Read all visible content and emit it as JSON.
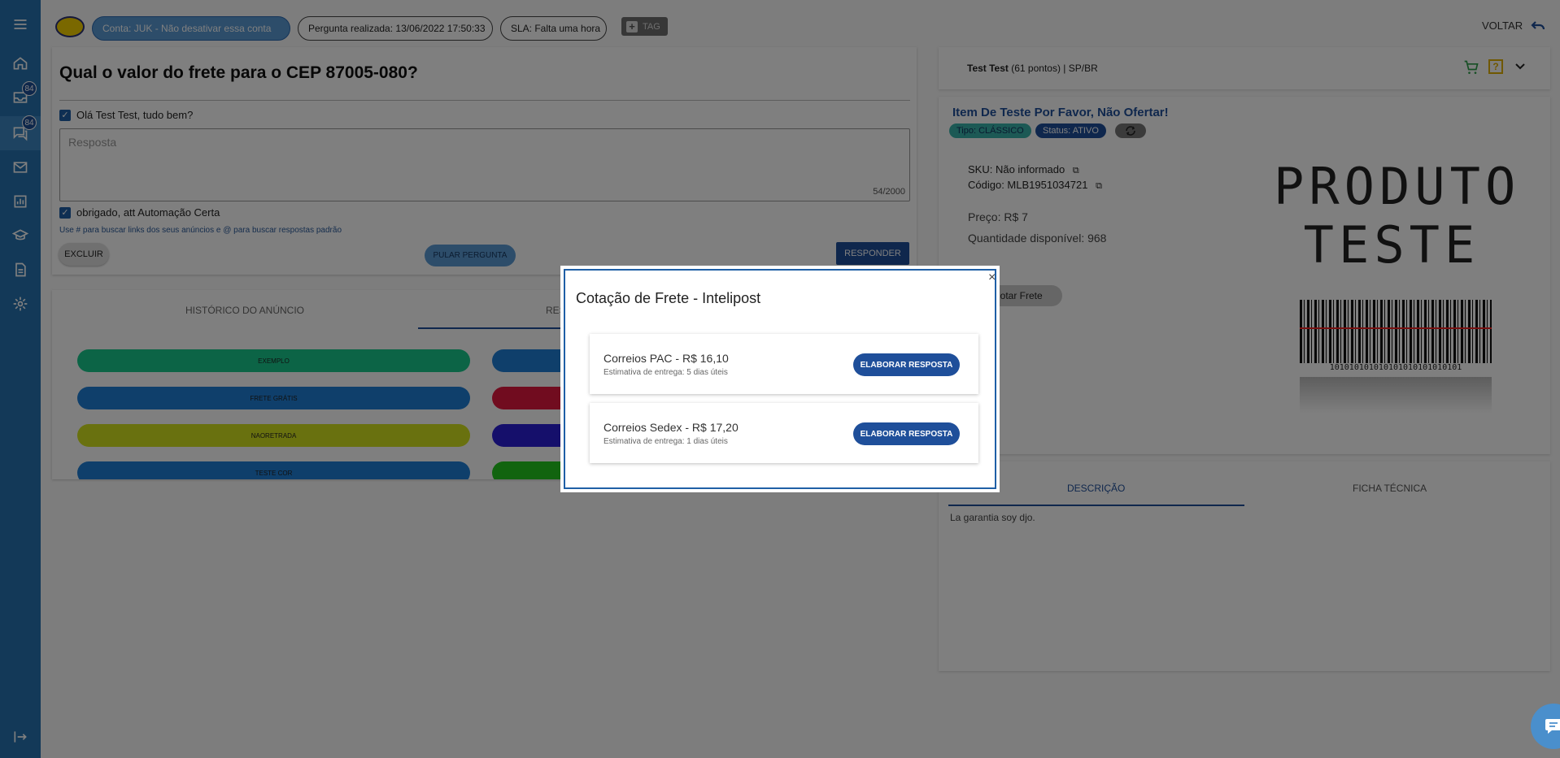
{
  "topbar": {
    "account_chip": "Conta: JUK - Não desativar essa conta",
    "date_chip": "Pergunta realizada: 13/06/2022 17:50:33",
    "sla_chip": "SLA: Falta uma hora",
    "tag_label": "TAG",
    "voltar_label": "VOLTAR"
  },
  "sidebar": {
    "badges": [
      "84",
      "84"
    ],
    "icons": [
      "menu-icon",
      "home-icon",
      "inbox-icon",
      "chat-icon",
      "mail-icon",
      "chart-icon",
      "school-icon",
      "document-icon",
      "gear-icon",
      "logout-icon"
    ]
  },
  "question": {
    "title": "Qual o valor do frete para o CEP 87005-080?",
    "greeting": "Olá Test Test, tudo bem?",
    "answer_placeholder": "Resposta",
    "char_count": "54/2000",
    "signature": "obrigado, att Automação Certa",
    "hint": "Use # para buscar links dos seus anúncios e @ para buscar respostas padrão",
    "excluir_label": "EXCLUIR",
    "pular_label": "PULAR PERGUNTA",
    "responder_label": "RESPONDER"
  },
  "tabs": {
    "historico": "HISTÓRICO DO ANÚNCIO",
    "respostas": "RES",
    "templates": [
      {
        "label": "EXEMPLO",
        "color": "#18c98d"
      },
      {
        "label": "FRETE GRÁTIS",
        "color": "#1f7fd6"
      },
      {
        "label": "NAORETRADA",
        "color": "#d3e21e"
      },
      {
        "label": "TESTE COR",
        "color": "#1f7fd6"
      }
    ],
    "right_template_colors": [
      "#1f7fd6",
      "#e3183f",
      "#2a1fd6",
      "#22c81e"
    ]
  },
  "seller": {
    "name": "Test Test",
    "points": "(61 pontos) | SP/BR"
  },
  "item": {
    "title": "Item De Teste Por Favor, Não Ofertar!",
    "tipo": "Tipo: CLÁSSICO",
    "status": "Status: ATIVO",
    "sku": "SKU: Não informado",
    "codigo": "Código: MLB1951034721",
    "preco": "Preço: R$ 7",
    "quantidade": "Quantidade disponível: 968",
    "cotar_frete": "Cotar Frete",
    "image_text_1": "PRODUTO",
    "image_text_2": "TESTE",
    "barcode_text": "101010101010101010101010101"
  },
  "description": {
    "tab_descricao": "DESCRIÇÃO",
    "tab_ficha": "FICHA TÉCNICA",
    "text": "La garantia soy djo."
  },
  "modal": {
    "title": "Cotação de Frete - Intelipost",
    "close": "×",
    "quotes": [
      {
        "name": "Correios PAC - R$ 16,10",
        "estimate": "Estimativa de entrega: 5 dias úteis",
        "button": "ELABORAR RESPOSTA"
      },
      {
        "name": "Correios Sedex - R$ 17,20",
        "estimate": "Estimativa de entrega: 1 dias úteis",
        "button": "ELABORAR RESPOSTA"
      }
    ]
  }
}
